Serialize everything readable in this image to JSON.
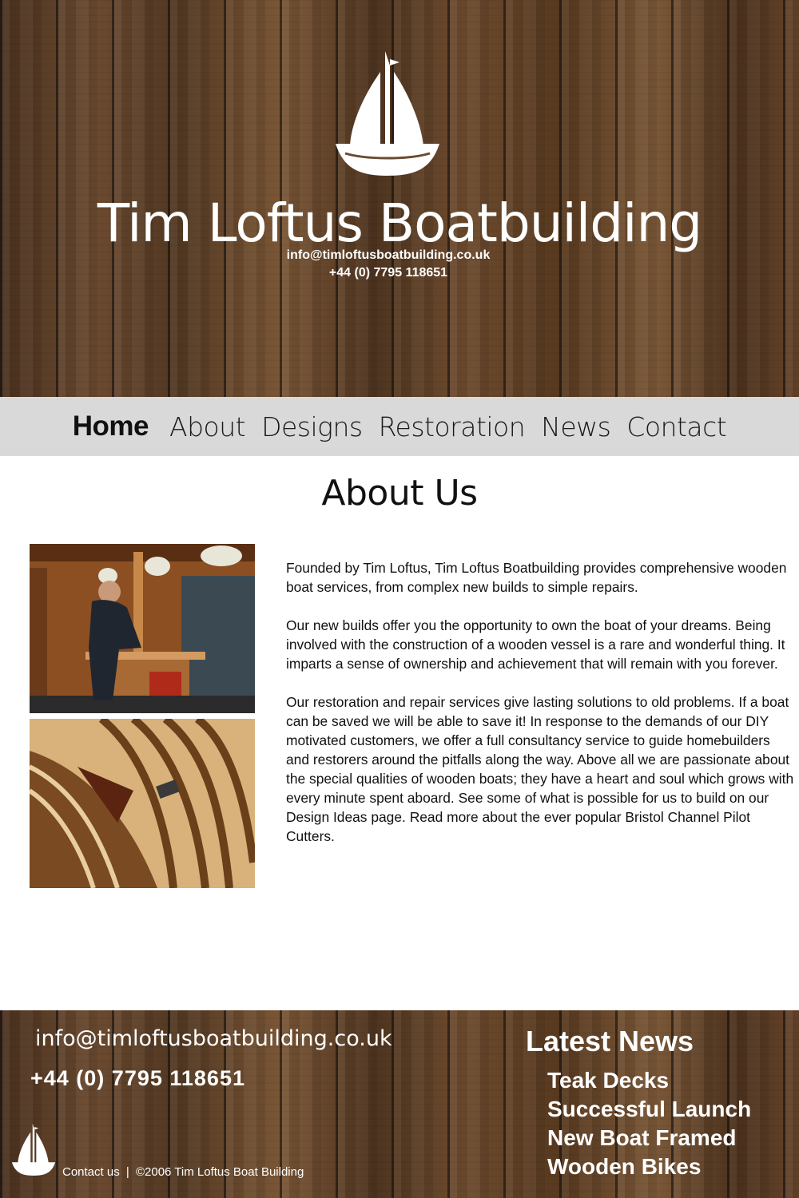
{
  "header": {
    "title": "Tim Loftus Boatbuilding",
    "email": "info@timloftusboatbuilding.co.uk",
    "phone": "+44 (0) 7795 118651",
    "logo_icon": "sailboat-icon"
  },
  "nav": {
    "items": [
      {
        "label": "Home",
        "active": true
      },
      {
        "label": "About",
        "active": false
      },
      {
        "label": "Designs",
        "active": false
      },
      {
        "label": "Restoration",
        "active": false
      },
      {
        "label": "News",
        "active": false
      },
      {
        "label": "Contact",
        "active": false
      }
    ]
  },
  "main": {
    "title": "About Us",
    "paragraphs": [
      "Founded by Tim Loftus, Tim Loftus Boatbuilding provides comprehensive wooden boat services, from complex new builds to simple repairs.",
      "Our new builds offer you the opportunity to own the boat of your dreams. Being involved with the construction of a wooden vessel is a rare and wonderful thing. It imparts a sense of ownership and achievement that will remain with you forever.",
      "Our restoration and repair services give lasting solutions to old problems. If a boat can be saved we will be able to save it! In response to the demands of our DIY motivated customers, we offer a full consultancy service to guide homebuilders and restorers around the pitfalls along the way. Above all we are passionate about the special qualities of wooden boats; they have a heart and soul which grows with every minute spent aboard. See some of what is possible for us to build on our Design Ideas page. Read more about the ever popular Bristol Channel Pilot Cutters."
    ]
  },
  "footer": {
    "email": "info@timloftusboatbuilding.co.uk",
    "phone": "+44 (0) 7795 118651",
    "contact_link": "Contact us",
    "separator": "|",
    "copyright": "©2006 Tim Loftus Boat Building",
    "news_heading": "Latest News",
    "news_items": [
      "Teak Decks",
      "Successful Launch",
      "New Boat Framed",
      "Wooden Bikes"
    ]
  },
  "colors": {
    "nav_background": "#d9d9d9",
    "text": "#111111",
    "wood": "#5a3d26"
  }
}
